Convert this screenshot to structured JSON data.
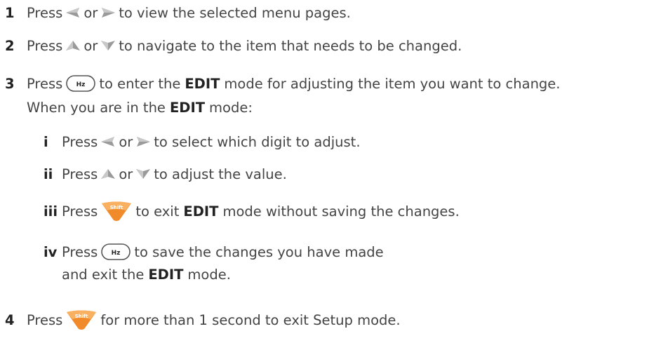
{
  "steps": [
    {
      "num": "1",
      "press": "Press",
      "or": "or",
      "rest": "to view the selected menu pages."
    },
    {
      "num": "2",
      "press": "Press",
      "or": "or",
      "rest": "to navigate to the item that needs to be changed."
    },
    {
      "num": "3",
      "press": "Press",
      "rest_a": "to enter the",
      "edit": "EDIT",
      "rest_b": "mode for adjusting the item you want to change.",
      "line2_a": "When you are in the",
      "line2_edit": "EDIT",
      "line2_b": "mode:"
    },
    {
      "num": "4",
      "press": "Press",
      "rest": "for more than 1 second to exit Setup mode."
    }
  ],
  "substeps": [
    {
      "num": "i",
      "press": "Press",
      "or": "or",
      "rest": "to select which digit to adjust."
    },
    {
      "num": "ii",
      "press": "Press",
      "or": "or",
      "rest": "to adjust the value."
    },
    {
      "num": "iii",
      "press": "Press",
      "rest_a": "to exit",
      "edit": "EDIT",
      "rest_b": "mode without saving the changes."
    },
    {
      "num": "iv",
      "press": "Press",
      "rest": "to save the changes you have made",
      "line2_a": "and exit the",
      "line2_edit": "EDIT",
      "line2_b": "mode."
    }
  ],
  "keys": {
    "hz_label": "Hz",
    "shift_label": "Shift"
  },
  "icons": {
    "left": "left-arrow-key-icon",
    "right": "right-arrow-key-icon",
    "up": "up-arrow-key-icon",
    "down": "down-arrow-key-icon",
    "hz": "hz-key-icon",
    "shift": "shift-key-icon"
  }
}
